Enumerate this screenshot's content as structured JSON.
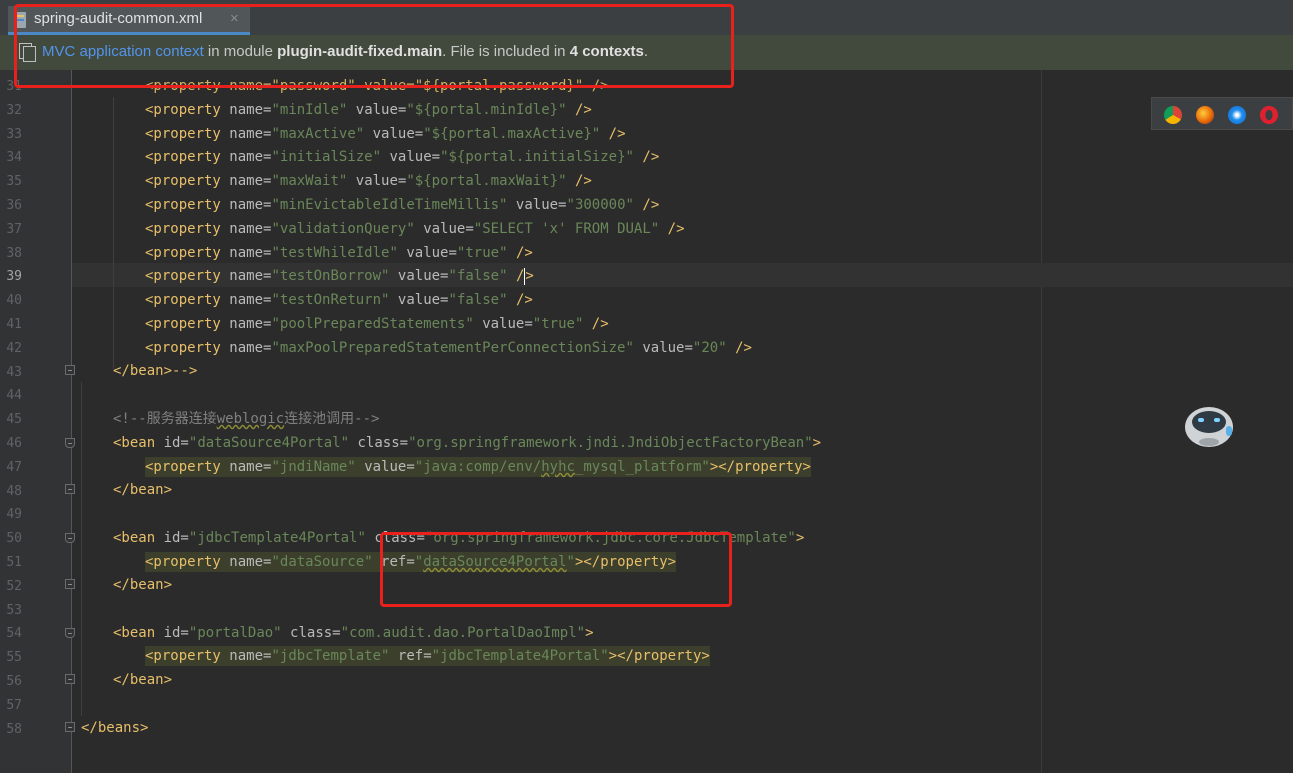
{
  "tab": {
    "title": "spring-audit-common.xml",
    "close": "×"
  },
  "infobar": {
    "link": "MVC application context",
    "text1": " in module ",
    "module": "plugin-audit-fixed.main",
    "text2": ". File is included in ",
    "contexts": "4 contexts",
    "text3": "."
  },
  "editor": {
    "current_line": "39",
    "lines": [
      {
        "n": "31",
        "code": "<property name=\"password\" value=\"${portal.password}\" />"
      },
      {
        "n": "32",
        "k": "minIdle",
        "v": "${portal.minIdle}"
      },
      {
        "n": "33",
        "k": "maxActive",
        "v": "${portal.maxActive}"
      },
      {
        "n": "34",
        "k": "initialSize",
        "v": "${portal.initialSize}"
      },
      {
        "n": "35",
        "k": "maxWait",
        "v": "${portal.maxWait}"
      },
      {
        "n": "36",
        "k": "minEvictableIdleTimeMillis",
        "v": "300000"
      },
      {
        "n": "37",
        "k": "validationQuery",
        "v": "SELECT 'x' FROM DUAL"
      },
      {
        "n": "38",
        "k": "testWhileIdle",
        "v": "true"
      },
      {
        "n": "39",
        "k": "testOnBorrow",
        "v": "false"
      },
      {
        "n": "40",
        "k": "testOnReturn",
        "v": "false"
      },
      {
        "n": "41",
        "k": "poolPreparedStatements",
        "v": "true"
      },
      {
        "n": "42",
        "k": "maxPoolPreparedStatementPerConnectionSize",
        "v": "20"
      },
      {
        "n": "43",
        "code": "</bean>-->"
      },
      {
        "n": "44"
      },
      {
        "n": "45",
        "comment_a": "<!--服务器连接",
        "comment_b": "weblogic",
        "comment_c": "连接池调用-->"
      },
      {
        "n": "46",
        "id": "dataSource4Portal",
        "cls": "org.springframework.jndi.JndiObjectFactoryBean"
      },
      {
        "n": "47",
        "name": "jndiName",
        "value_a": "java:comp/env/",
        "value_b": "hyhc",
        "value_c": "_mysql_platform"
      },
      {
        "n": "48",
        "code": "</bean>"
      },
      {
        "n": "49"
      },
      {
        "n": "50",
        "id": "jdbcTemplate4Portal",
        "cls": "org.springframework.jdbc.core.JdbcTemplate"
      },
      {
        "n": "51",
        "name": "dataSource",
        "ref": "dataSource4Portal"
      },
      {
        "n": "52",
        "code": "</bean>"
      },
      {
        "n": "53"
      },
      {
        "n": "54",
        "id": "portalDao",
        "cls": "com.audit.dao.PortalDaoImpl"
      },
      {
        "n": "55",
        "name": "jdbcTemplate",
        "ref": "jdbcTemplate4Portal"
      },
      {
        "n": "56",
        "code": "</bean>"
      },
      {
        "n": "57"
      },
      {
        "n": "58",
        "code": "</beans>"
      }
    ]
  },
  "browser_icons": [
    "chrome-icon",
    "firefox-icon",
    "safari-icon",
    "opera-icon"
  ],
  "colors": {
    "accent": "#4a88c7",
    "annotation": "#e8211c",
    "tag": "#e8bf6a",
    "string": "#6a8759"
  }
}
